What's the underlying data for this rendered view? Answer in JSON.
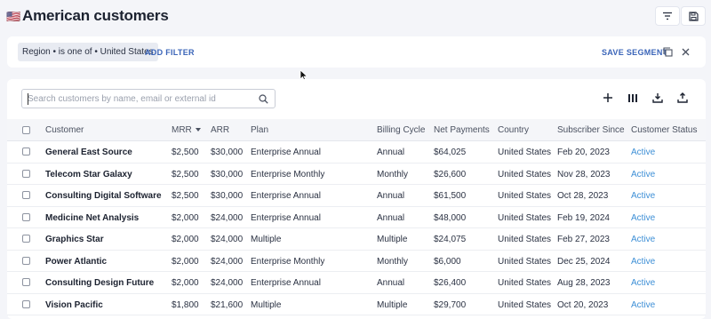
{
  "header": {
    "flag": "🇺🇸",
    "title": "American customers",
    "filter_icon": "filter-lines-icon",
    "save_icon": "floppy-disk-icon"
  },
  "filter_bar": {
    "chip": "Region • is one of • United States",
    "add_filter": "ADD FILTER",
    "save_segment": "SAVE SEGMENT"
  },
  "toolbar": {
    "search_placeholder": "Search customers by name, email or external id"
  },
  "table": {
    "columns": [
      "Customer",
      "MRR",
      "ARR",
      "Plan",
      "Billing Cycle",
      "Net Payments",
      "Country",
      "Subscriber Since",
      "Customer Status"
    ],
    "rows": [
      {
        "customer": "General East Source",
        "mrr": "$2,500",
        "arr": "$30,000",
        "plan": "Enterprise Annual",
        "billing": "Annual",
        "net": "$64,025",
        "country": "United States",
        "since": "Feb 20, 2023",
        "status": "Active"
      },
      {
        "customer": "Telecom Star Galaxy",
        "mrr": "$2,500",
        "arr": "$30,000",
        "plan": "Enterprise Monthly",
        "billing": "Monthly",
        "net": "$26,600",
        "country": "United States",
        "since": "Nov 28, 2023",
        "status": "Active"
      },
      {
        "customer": "Consulting Digital Software",
        "mrr": "$2,500",
        "arr": "$30,000",
        "plan": "Enterprise Annual",
        "billing": "Annual",
        "net": "$61,500",
        "country": "United States",
        "since": "Oct 28, 2023",
        "status": "Active"
      },
      {
        "customer": "Medicine Net Analysis",
        "mrr": "$2,000",
        "arr": "$24,000",
        "plan": "Enterprise Annual",
        "billing": "Annual",
        "net": "$48,000",
        "country": "United States",
        "since": "Feb 19, 2024",
        "status": "Active"
      },
      {
        "customer": "Graphics Star",
        "mrr": "$2,000",
        "arr": "$24,000",
        "plan": "Multiple",
        "billing": "Multiple",
        "net": "$24,075",
        "country": "United States",
        "since": "Feb 27, 2023",
        "status": "Active"
      },
      {
        "customer": "Power Atlantic",
        "mrr": "$2,000",
        "arr": "$24,000",
        "plan": "Enterprise Monthly",
        "billing": "Monthly",
        "net": "$6,000",
        "country": "United States",
        "since": "Dec 25, 2024",
        "status": "Active"
      },
      {
        "customer": "Consulting Design Future",
        "mrr": "$2,000",
        "arr": "$24,000",
        "plan": "Enterprise Annual",
        "billing": "Annual",
        "net": "$26,400",
        "country": "United States",
        "since": "Aug 28, 2023",
        "status": "Active"
      },
      {
        "customer": "Vision Pacific",
        "mrr": "$1,800",
        "arr": "$21,600",
        "plan": "Multiple",
        "billing": "Multiple",
        "net": "$29,700",
        "country": "United States",
        "since": "Oct 20, 2023",
        "status": "Active"
      }
    ]
  }
}
